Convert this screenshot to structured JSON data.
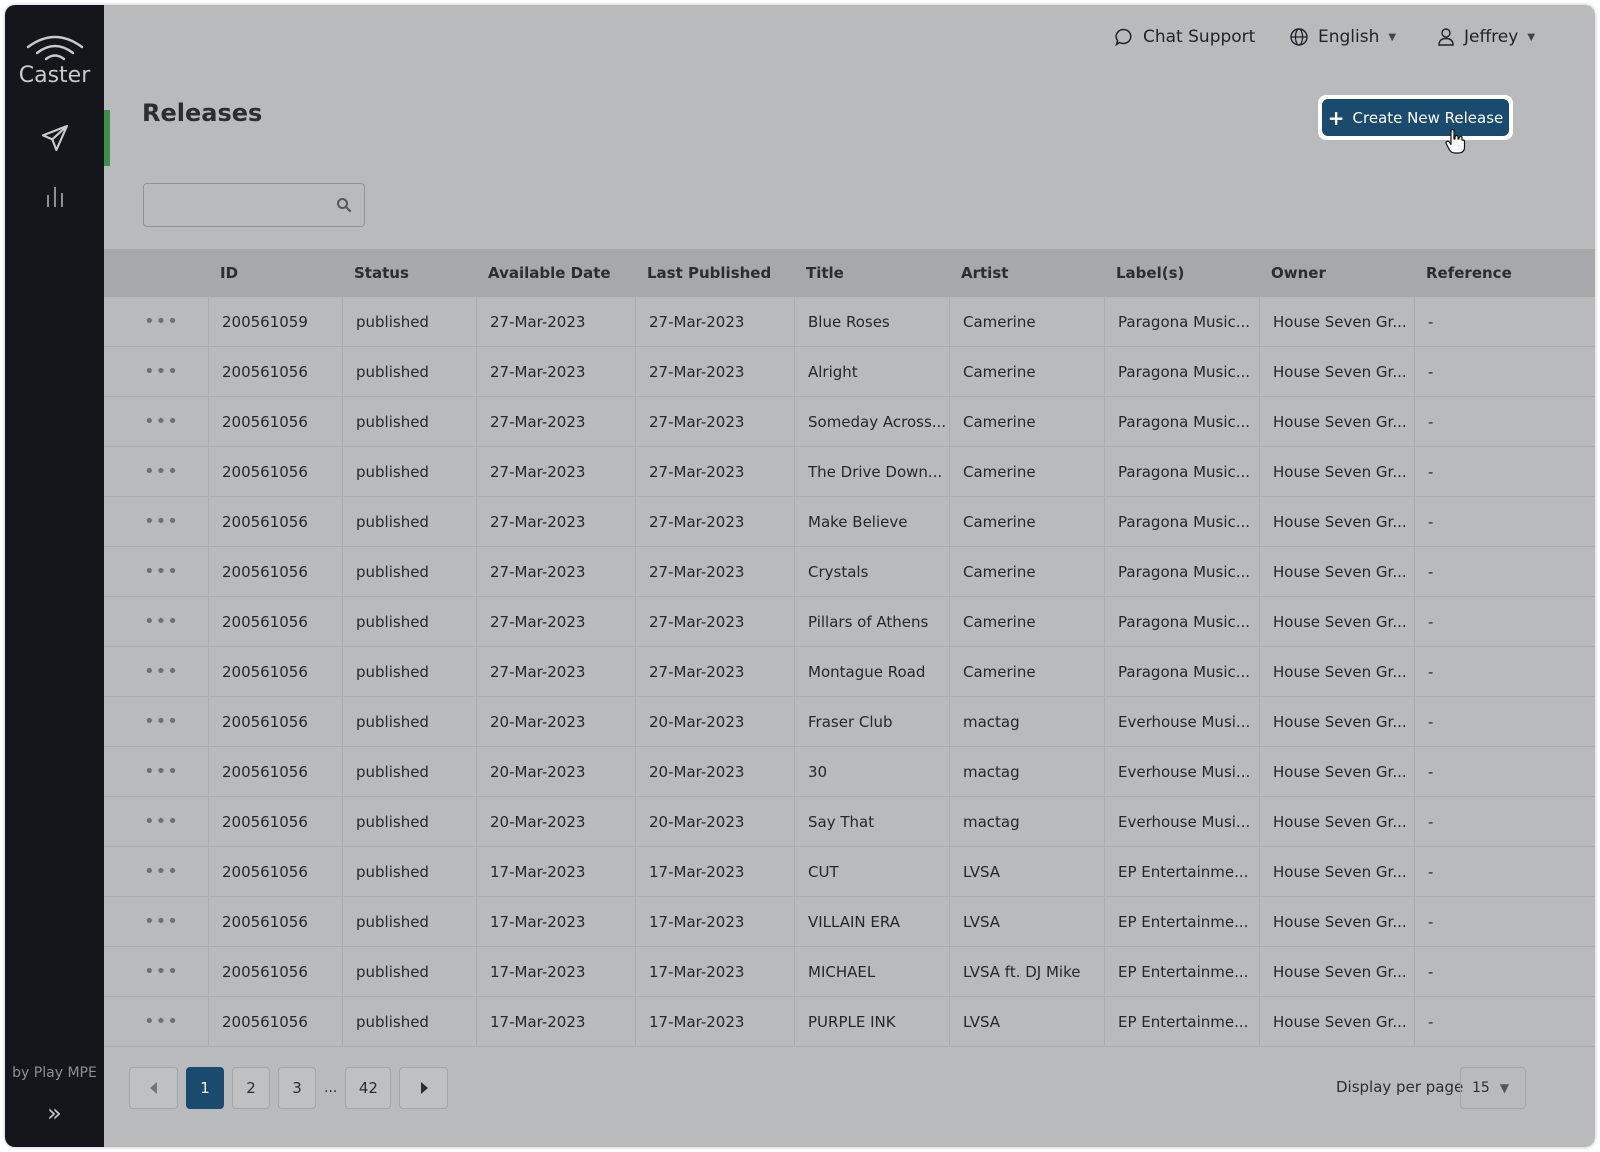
{
  "brand": {
    "name": "Caster",
    "byline": "by Play MPE"
  },
  "sidebar": {
    "items": [
      {
        "icon": "send-icon",
        "active": true
      },
      {
        "icon": "bar-chart-icon",
        "active": false
      }
    ],
    "expand_icon": "»"
  },
  "topbar": {
    "chat_support": "Chat Support",
    "language": "English",
    "user": "Jeffrey"
  },
  "page": {
    "title": "Releases",
    "create_button": "Create New Release"
  },
  "search": {
    "placeholder": "",
    "value": ""
  },
  "table": {
    "columns": [
      "",
      "ID",
      "Status",
      "Available Date",
      "Last Published",
      "Title",
      "Artist",
      "Label(s)",
      "Owner",
      "Reference"
    ],
    "rows": [
      {
        "menu": "•••",
        "id": "200561059",
        "status": "published",
        "available": "27-Mar-2023",
        "published": "27-Mar-2023",
        "title": "Blue Roses",
        "artist": "Camerine",
        "label": "Paragona Music...",
        "owner": "House Seven Gr...",
        "reference": "-"
      },
      {
        "menu": "•••",
        "id": "200561056",
        "status": "published",
        "available": "27-Mar-2023",
        "published": "27-Mar-2023",
        "title": "Alright",
        "artist": "Camerine",
        "label": "Paragona Music...",
        "owner": "House Seven Gr...",
        "reference": "-"
      },
      {
        "menu": "•••",
        "id": "200561056",
        "status": "published",
        "available": "27-Mar-2023",
        "published": "27-Mar-2023",
        "title": "Someday Across...",
        "artist": "Camerine",
        "label": "Paragona Music...",
        "owner": "House Seven Gr...",
        "reference": "-"
      },
      {
        "menu": "•••",
        "id": "200561056",
        "status": "published",
        "available": "27-Mar-2023",
        "published": "27-Mar-2023",
        "title": "The Drive Down...",
        "artist": "Camerine",
        "label": "Paragona Music...",
        "owner": "House Seven Gr...",
        "reference": "-"
      },
      {
        "menu": "•••",
        "id": "200561056",
        "status": "published",
        "available": "27-Mar-2023",
        "published": "27-Mar-2023",
        "title": "Make Believe",
        "artist": "Camerine",
        "label": "Paragona Music...",
        "owner": "House Seven Gr...",
        "reference": "-"
      },
      {
        "menu": "•••",
        "id": "200561056",
        "status": "published",
        "available": "27-Mar-2023",
        "published": "27-Mar-2023",
        "title": "Crystals",
        "artist": "Camerine",
        "label": "Paragona Music...",
        "owner": "House Seven Gr...",
        "reference": "-"
      },
      {
        "menu": "•••",
        "id": "200561056",
        "status": "published",
        "available": "27-Mar-2023",
        "published": "27-Mar-2023",
        "title": "Pillars of Athens",
        "artist": "Camerine",
        "label": "Paragona Music...",
        "owner": "House Seven Gr...",
        "reference": "-"
      },
      {
        "menu": "•••",
        "id": "200561056",
        "status": "published",
        "available": "27-Mar-2023",
        "published": "27-Mar-2023",
        "title": "Montague Road",
        "artist": "Camerine",
        "label": "Paragona Music...",
        "owner": "House Seven Gr...",
        "reference": "-"
      },
      {
        "menu": "•••",
        "id": "200561056",
        "status": "published",
        "available": "20-Mar-2023",
        "published": "20-Mar-2023",
        "title": "Fraser Club",
        "artist": "mactag",
        "label": "Everhouse Musi...",
        "owner": "House Seven Gr...",
        "reference": "-"
      },
      {
        "menu": "•••",
        "id": "200561056",
        "status": "published",
        "available": "20-Mar-2023",
        "published": "20-Mar-2023",
        "title": "30",
        "artist": "mactag",
        "label": "Everhouse Musi...",
        "owner": "House Seven Gr...",
        "reference": "-"
      },
      {
        "menu": "•••",
        "id": "200561056",
        "status": "published",
        "available": "20-Mar-2023",
        "published": "20-Mar-2023",
        "title": "Say That",
        "artist": "mactag",
        "label": "Everhouse Musi...",
        "owner": "House Seven Gr...",
        "reference": "-"
      },
      {
        "menu": "•••",
        "id": "200561056",
        "status": "published",
        "available": "17-Mar-2023",
        "published": "17-Mar-2023",
        "title": "CUT",
        "artist": "LVSA",
        "label": "EP Entertainme...",
        "owner": "House Seven Gr...",
        "reference": "-"
      },
      {
        "menu": "•••",
        "id": "200561056",
        "status": "published",
        "available": "17-Mar-2023",
        "published": "17-Mar-2023",
        "title": "VILLAIN ERA",
        "artist": "LVSA",
        "label": "EP Entertainme...",
        "owner": "House Seven Gr...",
        "reference": "-"
      },
      {
        "menu": "•••",
        "id": "200561056",
        "status": "published",
        "available": "17-Mar-2023",
        "published": "17-Mar-2023",
        "title": "MICHAEL",
        "artist": "LVSA ft. DJ Mike",
        "label": "EP Entertainme...",
        "owner": "House Seven Gr...",
        "reference": "-"
      },
      {
        "menu": "•••",
        "id": "200561056",
        "status": "published",
        "available": "17-Mar-2023",
        "published": "17-Mar-2023",
        "title": "PURPLE INK",
        "artist": "LVSA",
        "label": "EP Entertainme...",
        "owner": "House Seven Gr...",
        "reference": "-"
      }
    ]
  },
  "pagination": {
    "pages": [
      "1",
      "2",
      "3"
    ],
    "ellipsis": "...",
    "last_page": "42",
    "current": "1",
    "per_page_label": "Display per page",
    "per_page_value": "15"
  },
  "colors": {
    "accent": "#1a4a6e",
    "active_indicator": "#3f8f4b",
    "sidebar_bg": "#14161b"
  }
}
